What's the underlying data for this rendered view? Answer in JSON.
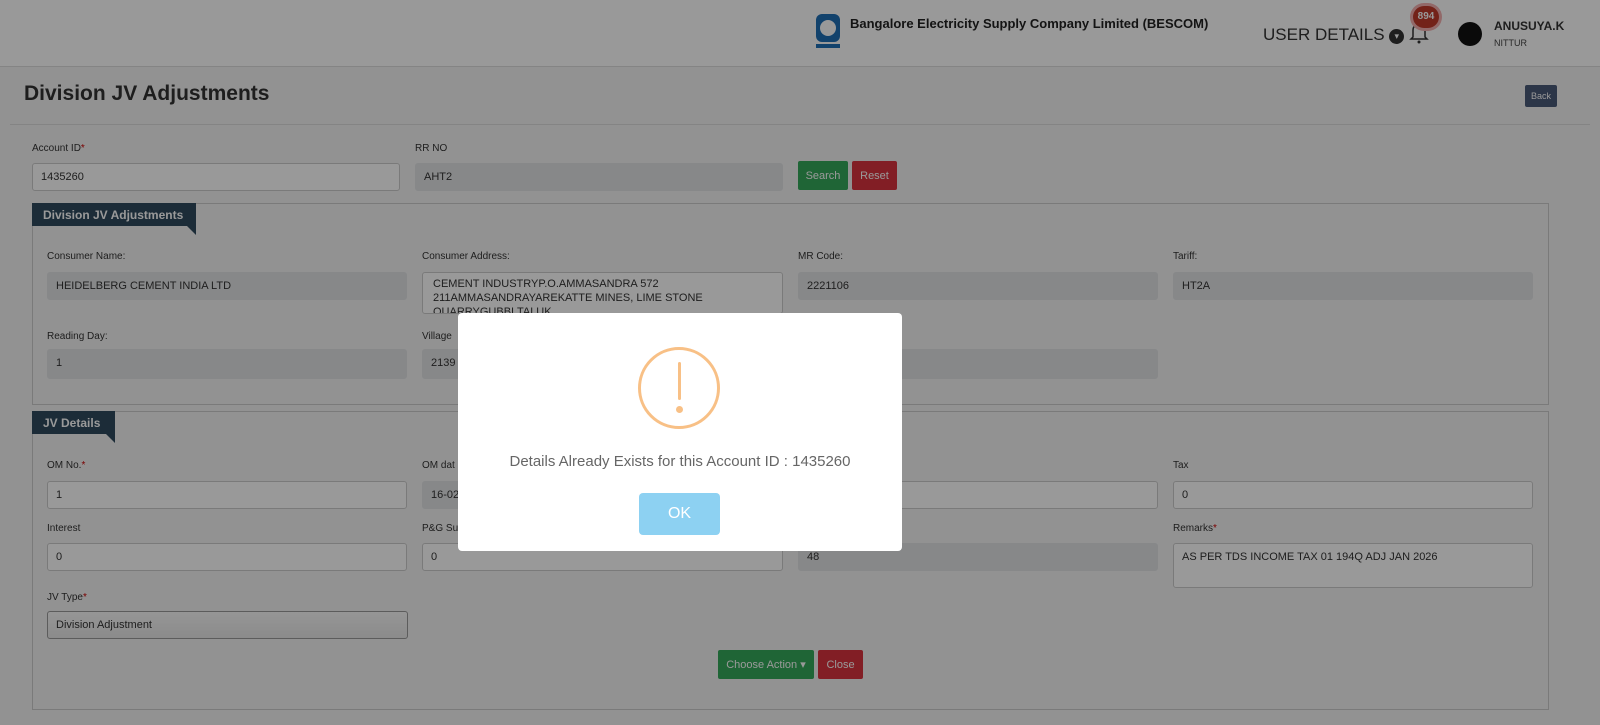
{
  "header": {
    "company": "Bangalore Electricity Supply Company Limited (BESCOM)",
    "user_details": "USER DETAILS",
    "notification_count": "894",
    "user_name": "ANUSUYA.K",
    "user_location": "NITTUR"
  },
  "page": {
    "title": "Division JV Adjustments",
    "back": "Back"
  },
  "search": {
    "account_label": "Account ID",
    "account_value": "1435260",
    "rr_label": "RR NO",
    "rr_value": "AHT2",
    "search": "Search",
    "reset": "Reset"
  },
  "consumer": {
    "tab": "Division JV Adjustments",
    "name_label": "Consumer Name:",
    "name": "HEIDELBERG CEMENT INDIA LTD",
    "address_label": "Consumer Address:",
    "address": "CEMENT INDUSTRYP.O.AMMASANDRA 572 211AMMASANDRAYAREKATTE MINES, LIME STONE QUARRYGUBBI TALUK",
    "mr_label": "MR Code:",
    "mr": "2221106",
    "tariff_label": "Tariff:",
    "tariff": "HT2A",
    "reading_label": "Reading Day:",
    "reading": "1",
    "village_label": "Village",
    "village": "2139"
  },
  "jv": {
    "tab": "JV Details",
    "om_no_label": "OM No.",
    "om_no": "1",
    "om_date_label": "OM dat",
    "om_date": "16-02",
    "tax_label": "Tax",
    "tax": "0",
    "interest_label": "Interest",
    "interest": "0",
    "pg_label": "P&G Su",
    "pg": "0",
    "third_value": "48",
    "remarks_label": "Remarks",
    "remarks": "AS PER TDS INCOME TAX 01 194Q ADJ JAN 2026",
    "jv_type_label": "JV Type",
    "jv_type": "Division Adjustment",
    "choose_action": "Choose Action ▾",
    "close": "Close"
  },
  "dialog": {
    "message": "Details Already Exists for this Account ID : 1435260",
    "ok": "OK"
  }
}
